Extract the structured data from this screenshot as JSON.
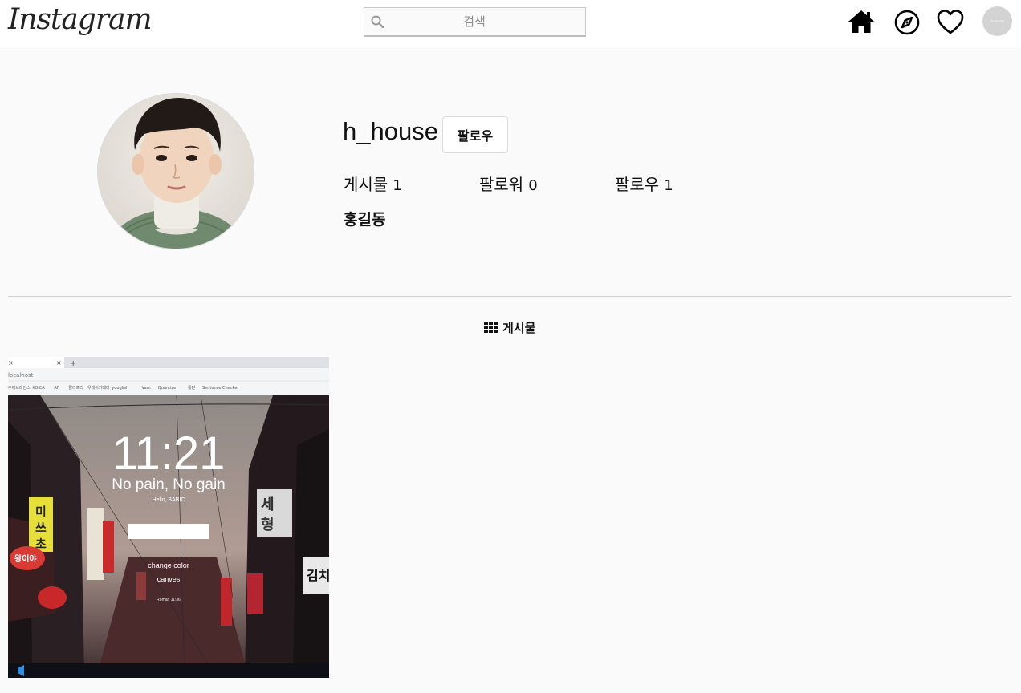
{
  "header": {
    "logo": "Instagram",
    "search_placeholder": "검색",
    "avatar_label": "h-house"
  },
  "profile": {
    "username": "h_house",
    "follow_label": "팔로우",
    "stats": {
      "posts_label": "게시물",
      "posts_count": "1",
      "followers_label": "팔로워",
      "followers_count": "0",
      "following_label": "팔로우",
      "following_count": "1"
    },
    "real_name": "홍길동"
  },
  "tabs": {
    "posts_label": "게시물"
  },
  "post": {
    "address_bar": "localhost",
    "bookmarks": [
      "주제브레인스",
      "KOICA",
      "AF",
      "칼라프리",
      "우레이카데미",
      "youglish",
      "Vam",
      "Quantize",
      "통판",
      "Sentence Checker"
    ],
    "clock": "11:21",
    "motto": "No pain, No gain",
    "greeting": "Hello, BABIC",
    "menu_change_color": "change color",
    "menu_canvas": "canves",
    "verse": "Roman 11:36"
  }
}
